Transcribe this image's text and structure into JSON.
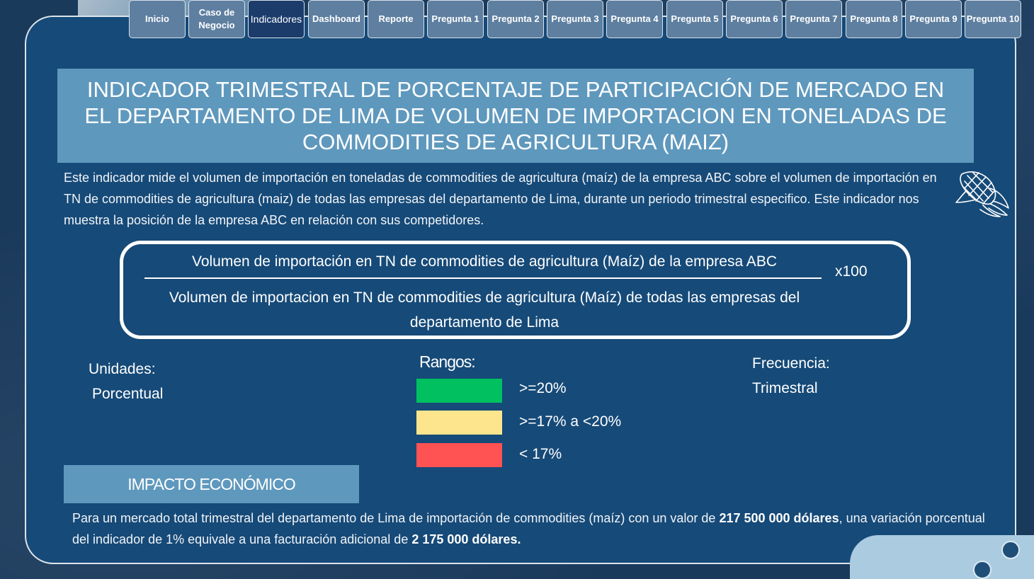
{
  "nav": {
    "items": [
      {
        "label": "Inicio",
        "active": false
      },
      {
        "label": "Caso de Negocio",
        "active": false
      },
      {
        "label": "Indicadores",
        "active": true
      },
      {
        "label": "Dashboard",
        "active": false
      },
      {
        "label": "Reporte",
        "active": false
      },
      {
        "label": "Pregunta 1",
        "active": false
      },
      {
        "label": "Pregunta 2",
        "active": false
      },
      {
        "label": "Pregunta 3",
        "active": false
      },
      {
        "label": "Pregunta 4",
        "active": false
      },
      {
        "label": "Pregunta 5",
        "active": false
      },
      {
        "label": "Pregunta 6",
        "active": false
      },
      {
        "label": "Pregunta 7",
        "active": false
      },
      {
        "label": "Pregunta 8",
        "active": false
      },
      {
        "label": "Pregunta 9",
        "active": false
      },
      {
        "label": "Pregunta 10",
        "active": false
      }
    ]
  },
  "header": {
    "title": "INDICADOR TRIMESTRAL DE PORCENTAJE DE PARTICIPACIÓN DE MERCADO EN EL DEPARTAMENTO DE LIMA DE VOLUMEN DE IMPORTACION EN TONELADAS DE COMMODITIES DE AGRICULTURA (MAIZ)"
  },
  "description": "Este indicador mide el volumen de importación en toneladas de commodities de agricultura (maíz) de la empresa ABC sobre el volumen de importación en TN de commodities de agricultura (maiz) de todas las empresas del departamento de Lima, durante un periodo trimestral especifico. Este indicador nos muestra la posición de la empresa ABC en relación con sus competidores.",
  "icons": {
    "corn": "corn-icon"
  },
  "formula": {
    "numerator": "Volumen de importación en TN de commodities de agricultura (Maíz) de la empresa ABC",
    "denominator": "Volumen de importacion en TN de commodities de agricultura (Maíz) de todas las empresas del departamento de Lima",
    "multiplier": "x100"
  },
  "units": {
    "label": "Unidades:",
    "value": "Porcentual"
  },
  "ranges": {
    "label": "Rangos:",
    "items": [
      {
        "label": ">=20%",
        "color": "#00c060"
      },
      {
        "label": ">=17% a <20%",
        "color": "#fde58e"
      },
      {
        "label": "< 17%",
        "color": "#ff5252"
      }
    ]
  },
  "frequency": {
    "label": "Frecuencia:",
    "value": "Trimestral"
  },
  "impact": {
    "title": "IMPACTO ECONÓMICO",
    "text_1": "Para un mercado total trimestral del departamento de Lima de importación de commodities (maíz) con un valor de ",
    "amount_1": "217 500 000 dólares",
    "text_2": ", una variación porcentual del indicador de 1% equivale a una facturación adicional de ",
    "amount_2": "2 175 000 dólares."
  },
  "colors": {
    "background": "#1d3f62",
    "panel": "#164a78",
    "title_box": "#5f98bd",
    "nav_button": "#5e7fa0",
    "nav_active": "#1c3c6c"
  }
}
